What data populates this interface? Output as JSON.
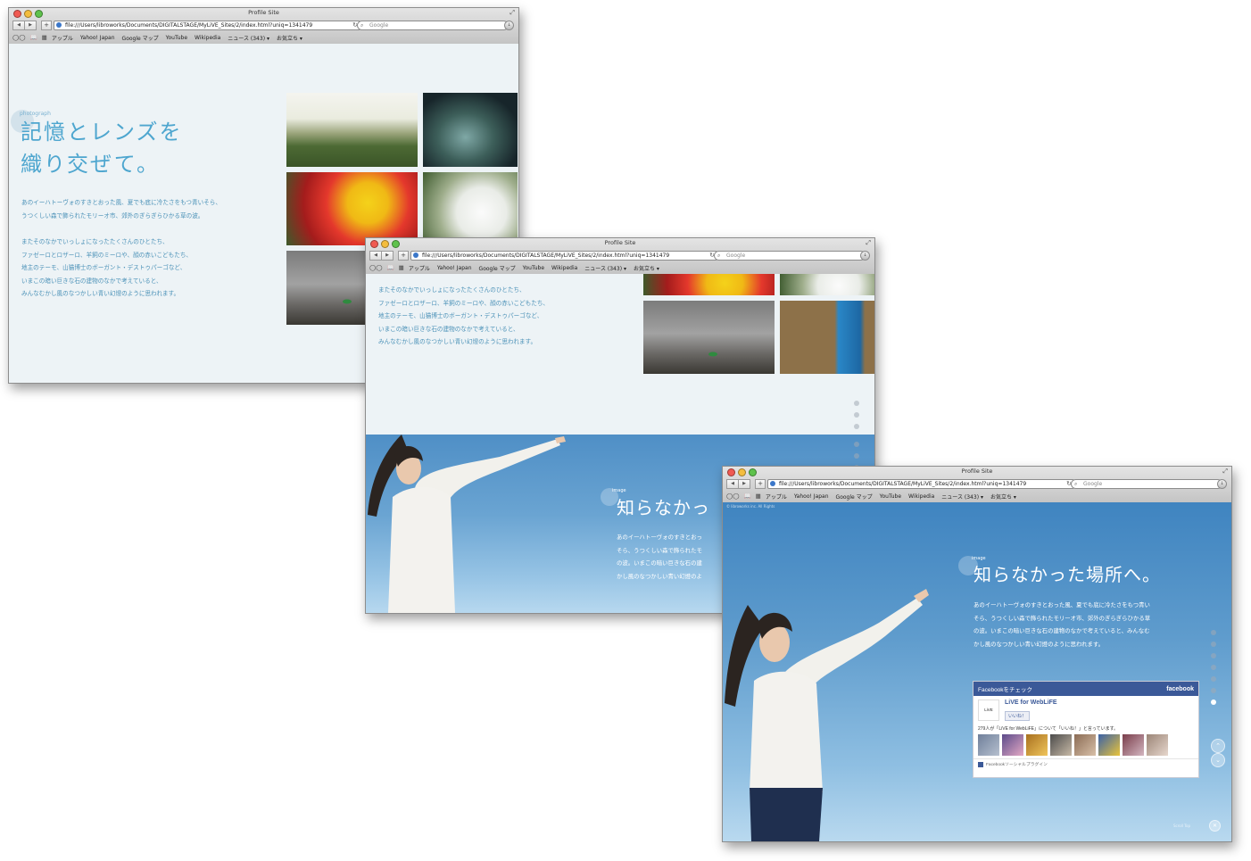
{
  "browser": {
    "window_title": "Profile Site",
    "url": "file:///Users/libroworks/Documents/DIGITALSTAGE/MyLiVE_Sites/2/index.html?uniq=1341479",
    "search_placeholder": "Google",
    "bookmarks": [
      "アップル",
      "Yahoo! Japan",
      "Google マップ",
      "YouTube",
      "Wikipedia",
      "ニュース (343) ▾",
      "お気立ち ▾"
    ]
  },
  "window1": {
    "eyebrow": "photograph",
    "heading": "記憶とレンズを\n織り交ぜて。",
    "paragraph1": "あのイーハトーヴォのすきとおった風、夏でも底に冷たさをもつ青いそら、\nうつくしい森で飾られたモリーオ市、郊外のぎらぎらひかる草の波。",
    "paragraph2": "またそのなかでいっしょになったたくさんのひとたち、\nファゼーロとロザーロ、羊飼のミーロや、顔の赤いこどもたち、\n地主のテーモ、山猫博士のボーガント・デストゥパーゴなど、\nいまこの暗い巨きな石の建物のなかで考えていると、\nみんなむかし風のなつかしい青い幻燈のように思われます。",
    "photos": [
      "trees-against-sky",
      "reflection-in-water",
      "lily-flowers",
      "white-hydrangea",
      "beetle-on-rock"
    ]
  },
  "window2": {
    "paragraph": "またそのなかでいっしょになったたくさんのひとたち、\nファゼーロとロザーロ、羊飼のミーロや、顔の赤いこどもたち、\n地主のテーモ、山猫博士のボーガント・デストゥパーゴなど、\nいまこの暗い巨きな石の建物のなかで考えていると、\nみんなむかし風のなつかしい青い幻燈のように思われます。",
    "photos": [
      "lily-flowers",
      "white-hydrangea",
      "beetle-on-rock",
      "blue-bench-leaves"
    ],
    "hero_eyebrow": "image",
    "hero_title": "知らなかっ",
    "hero_body": "あのイーハトーヴォのすきとおっ\nそら、うつくしい森で飾られたモ\nの波。いまこの暗い巨きな石の建\nかし風のなつかしい青い幻燈のよ"
  },
  "window3": {
    "top_note": "© libroworks inc. All Rights",
    "hero_eyebrow": "image",
    "hero_title": "知らなかった場所へ。",
    "hero_body": "あのイーハトーヴォのすきとおった風、夏でも底に冷たさをもつ青い\nそら、うつくしい森で飾られたモリーオ市、郊外のぎらぎらひかる草\nの波。いまこの暗い巨きな石の建物のなかで考えていると、みんなむ\nかし風のなつかしい青い幻燈のように思われます。",
    "facebook": {
      "header": "Facebookをチェック",
      "brand": "facebook",
      "logo_text": "LiVE",
      "page_name": "LiVE for WebLiFE",
      "like_button": "いいね！",
      "fan_count": "279人が「LiVE for WebLiFE」について「いいね！」と言っています。",
      "footer": "Facebookソーシャルプラグイン"
    },
    "footer_small": "Scroll Top"
  },
  "colors": {
    "accent_blue": "#4ea6cf",
    "facebook_blue": "#3b5998",
    "sky_blue": "#6aa4d2"
  }
}
